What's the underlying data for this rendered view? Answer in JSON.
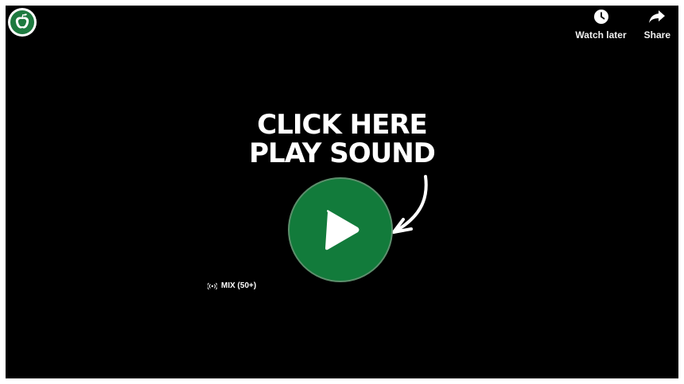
{
  "player": {
    "channel_logo_icon": "apple-logo-icon",
    "actions": [
      {
        "id": "watch-later",
        "label": "Watch later",
        "icon": "clock-icon"
      },
      {
        "id": "share",
        "label": "Share",
        "icon": "share-arrow-icon"
      }
    ],
    "headline": {
      "line1": "CLICK HERE",
      "line2": "PLAY SOUND"
    },
    "play_icon": "play-icon",
    "mix": {
      "icon": "broadcast-icon",
      "label": "MIX (50+)"
    },
    "colors": {
      "background": "#000000",
      "play_button": "#127b3b",
      "logo_green": "#1d7a3f",
      "text": "#ffffff"
    }
  }
}
